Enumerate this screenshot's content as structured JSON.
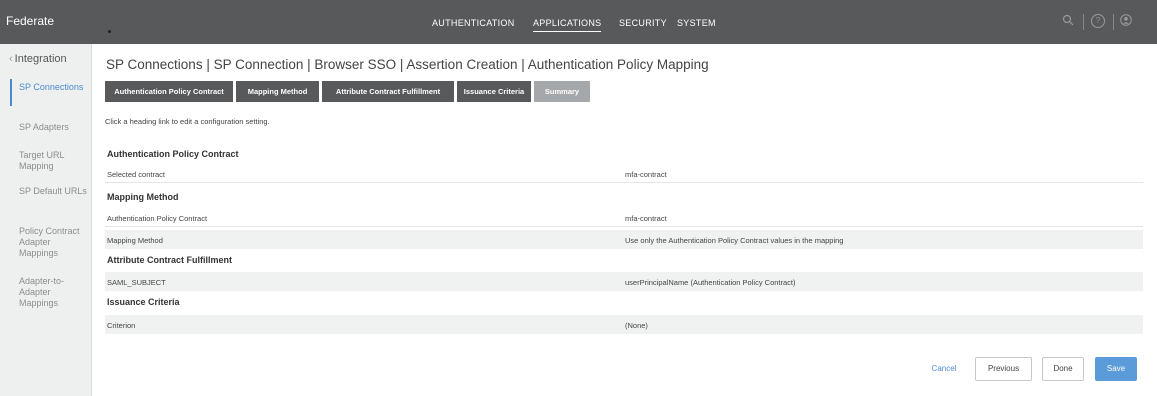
{
  "app": {
    "logo": "Federate"
  },
  "nav": {
    "items": [
      {
        "label": "AUTHENTICATION"
      },
      {
        "label": "APPLICATIONS"
      },
      {
        "label": "SECURITY"
      },
      {
        "label": "SYSTEM"
      }
    ],
    "active": "APPLICATIONS"
  },
  "sidebar": {
    "back_label": "Integration",
    "items": [
      {
        "label": "SP Connections"
      },
      {
        "label": "SP Adapters"
      },
      {
        "label": "Target URL Mapping"
      },
      {
        "label": "SP Default URLs"
      },
      {
        "label": "Policy Contract Adapter Mappings"
      },
      {
        "label": "Adapter-to-Adapter Mappings"
      }
    ]
  },
  "main": {
    "breadcrumb": "SP Connections | SP Connection | Browser SSO | Assertion Creation | Authentication Policy Mapping",
    "tabs": [
      {
        "label": "Authentication Policy Contract"
      },
      {
        "label": "Mapping Method"
      },
      {
        "label": "Attribute Contract Fulfillment"
      },
      {
        "label": "Issuance Criteria"
      },
      {
        "label": "Summary"
      }
    ],
    "hint": "Click a heading link to edit a configuration setting.",
    "sections": [
      {
        "title": "Authentication Policy Contract",
        "rows": [
          {
            "key": "Selected contract",
            "value": "mfa-contract"
          }
        ]
      },
      {
        "title": "Mapping Method",
        "rows": [
          {
            "key": "Authentication Policy Contract",
            "value": "mfa-contract"
          },
          {
            "key": "Mapping Method",
            "value": "Use only the Authentication Policy Contract values in the mapping"
          }
        ]
      },
      {
        "title": "Attribute Contract Fulfillment",
        "rows": [
          {
            "key": "SAML_SUBJECT",
            "value": "userPrincipalName (Authentication Policy Contract)"
          }
        ]
      },
      {
        "title": "Issuance Criteria",
        "rows": [
          {
            "key": "Criterion",
            "value": "(None)"
          }
        ]
      }
    ]
  },
  "buttons": {
    "cancel": "Cancel",
    "previous": "Previous",
    "done": "Done",
    "save": "Save"
  },
  "icons": {
    "search": "search-icon",
    "help": "help-icon",
    "user": "user-icon"
  },
  "colors": {
    "topbar": "#58595b",
    "accent": "#5b9bd9",
    "active_tab": "#a5a8ab"
  }
}
